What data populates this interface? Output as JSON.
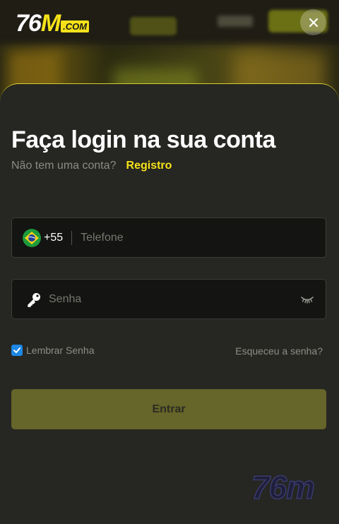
{
  "logo": {
    "num": "76",
    "m": "M",
    "com": ".COM"
  },
  "modal": {
    "title": "Faça login na sua conta",
    "subtitle": "Não tem uma conta?",
    "register_link": "Registro"
  },
  "phone": {
    "dial_code": "+55",
    "placeholder": "Telefone"
  },
  "password": {
    "placeholder": "Senha"
  },
  "remember": {
    "label": "Lembrar Senha",
    "checked": true
  },
  "forgot_link": "Esqueceu a senha?",
  "submit_label": "Entrar",
  "watermark": "76m",
  "colors": {
    "accent": "#f5e21a",
    "sheet_bg": "#262622",
    "field_bg": "#141412",
    "button_bg": "#66652a",
    "checkbox": "#1e88e5"
  },
  "icons": {
    "close": "close-icon",
    "flag": "brazil-flag-icon",
    "key": "key-icon",
    "eye": "eye-closed-icon",
    "check": "check-icon"
  }
}
